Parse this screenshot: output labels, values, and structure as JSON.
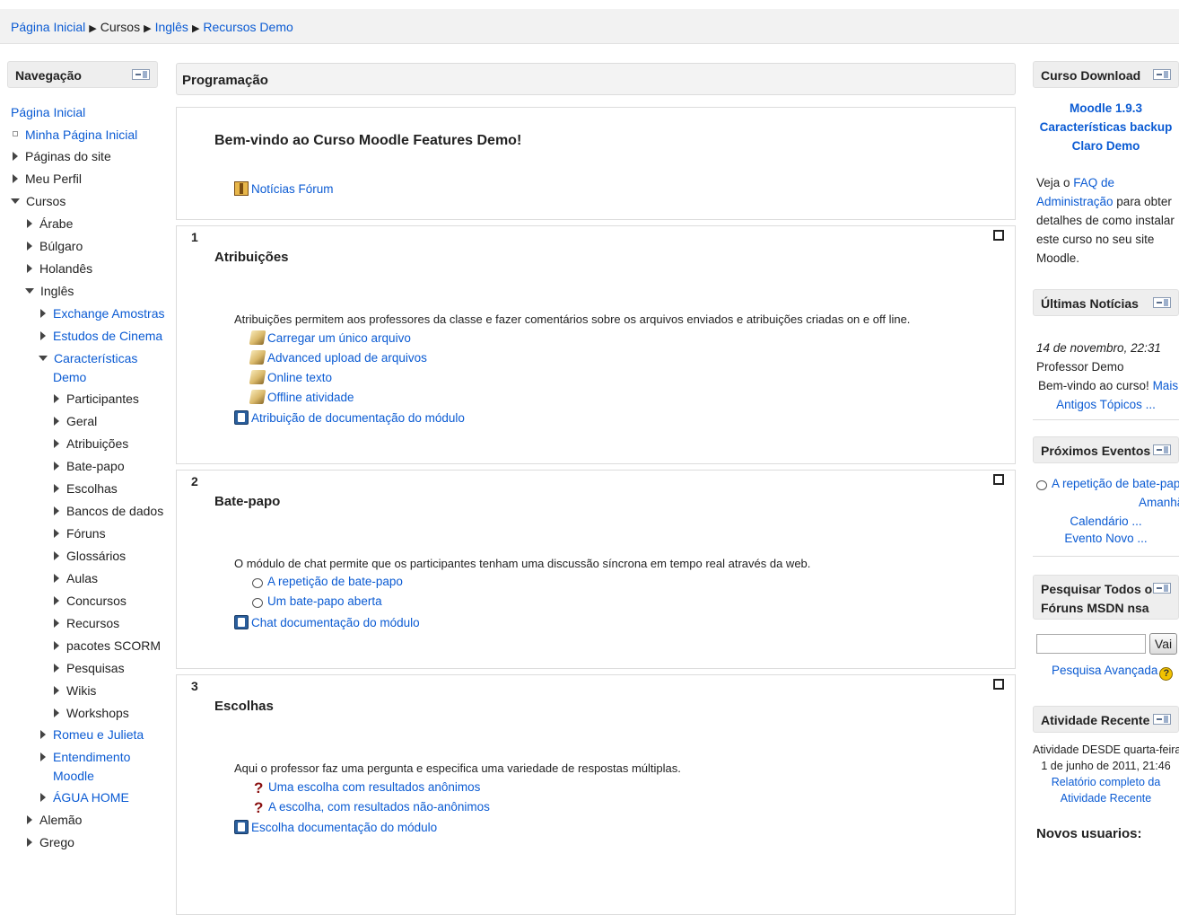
{
  "breadcrumb": {
    "home": "Página Inicial",
    "courses": "Cursos",
    "english": "Inglês",
    "current": "Recursos Demo"
  },
  "nav_block": {
    "title": "Navegação",
    "items": [
      {
        "label": "Página Inicial"
      },
      {
        "label": "Minha Página Inicial"
      },
      {
        "label": "Páginas do site"
      },
      {
        "label": "Meu Perfil"
      },
      {
        "label": "Cursos"
      },
      {
        "label": "Árabe"
      },
      {
        "label": "Búlgaro"
      },
      {
        "label": "Holandês"
      },
      {
        "label": "Inglês"
      },
      {
        "label": "Exchange Amostras"
      },
      {
        "label": "Estudos de Cinema"
      },
      {
        "label": "Características"
      },
      {
        "label": "Demo"
      },
      {
        "label": "Participantes"
      },
      {
        "label": "Geral"
      },
      {
        "label": "Atribuições"
      },
      {
        "label": "Bate-papo"
      },
      {
        "label": "Escolhas"
      },
      {
        "label": "Bancos de dados"
      },
      {
        "label": "Fóruns"
      },
      {
        "label": "Glossários"
      },
      {
        "label": "Aulas"
      },
      {
        "label": "Concursos"
      },
      {
        "label": "Recursos"
      },
      {
        "label": "pacotes SCORM"
      },
      {
        "label": "Pesquisas"
      },
      {
        "label": "Wikis"
      },
      {
        "label": "Workshops"
      },
      {
        "label": "Romeu e Julieta"
      },
      {
        "label": "Entendimento"
      },
      {
        "label": "Moodle"
      },
      {
        "label": "ÁGUA HOME"
      },
      {
        "label": "Alemão"
      },
      {
        "label": "Grego"
      }
    ]
  },
  "main": {
    "header": "Programação",
    "welcome": {
      "title": "Bem-vindo ao Curso Moodle Features Demo!",
      "forum_link": "Notícias Fórum"
    },
    "sections": [
      {
        "number": "1",
        "title": "Atribuições",
        "summary": "Atribuições permitem aos professores da classe e fazer comentários sobre os arquivos enviados e atribuições criadas on e off line.",
        "activities": [
          "Carregar um único arquivo",
          "Advanced upload de arquivos",
          "Online texto",
          "Offline atividade"
        ],
        "doc": "Atribuição de documentação do módulo"
      },
      {
        "number": "2",
        "title": "Bate-papo",
        "summary": "O módulo de chat permite que os participantes tenham uma discussão síncrona em tempo real através da web.",
        "activities": [
          "A repetição de bate-papo",
          "Um bate-papo aberta"
        ],
        "doc": "Chat documentação do módulo"
      },
      {
        "number": "3",
        "title": "Escolhas",
        "summary": "Aqui o professor faz uma pergunta e especifica uma variedade de respostas múltiplas.",
        "activities": [
          "Uma escolha com resultados anônimos",
          "A escolha, com resultados não-anônimos"
        ],
        "doc": "Escolha documentação do módulo"
      }
    ]
  },
  "right": {
    "download": {
      "title": "Curso Download",
      "link_line1": "Moodle 1.9.3",
      "link_line2": "Características backup",
      "link_line3": "Claro Demo",
      "text_prefix": "Veja o ",
      "faq_link_1": "FAQ de",
      "faq_link_2": "Administração",
      "text_suffix": " para obter",
      "text_line3": "detalhes de como instalar",
      "text_line4": "este curso no seu site",
      "text_line5": "Moodle."
    },
    "news": {
      "title": "Últimas Notícias",
      "date": "14 de novembro, 22:31",
      "author": "Professor Demo",
      "text": "Bem-vindo ao curso! ",
      "more": "Mais ...",
      "older": "Antigos Tópicos ..."
    },
    "events": {
      "title": "Próximos Eventos",
      "event": "A repetição de bate-papo",
      "when": "Amanhã",
      "calendar": "Calendário ...",
      "new_event": "Evento Novo ..."
    },
    "search": {
      "title_line1": "Pesquisar Todos os",
      "title_line2": "Fóruns MSDN nsa",
      "input_value": "",
      "button": "Vai",
      "advanced": "Pesquisa Avançada",
      "help": "?"
    },
    "recent": {
      "title": "Atividade Recente",
      "line1": "Atividade DESDE quarta-feira,",
      "line2": "1 de junho de 2011, 21:46",
      "report1": "Relatório completo da",
      "report2": "Atividade Recente",
      "new_users": "Novos usuarios:"
    }
  }
}
